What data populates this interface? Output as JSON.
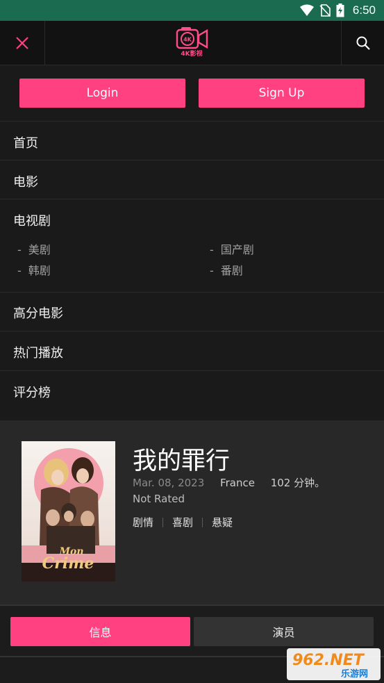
{
  "status_bar": {
    "time": "6:50"
  },
  "header": {
    "logo_text": "4K影视",
    "logo_badge": "4K"
  },
  "auth": {
    "login_label": "Login",
    "signup_label": "Sign Up"
  },
  "menu": {
    "home": "首页",
    "movies": "电影",
    "tv": "电视剧",
    "tv_sub": [
      "美剧",
      "国产剧",
      "韩剧",
      "番剧"
    ],
    "top_rated_movies": "高分电影",
    "hot": "热门播放",
    "ranking": "评分榜"
  },
  "movie": {
    "title": "我的罪行",
    "date": "Mar. 08, 2023",
    "country": "France",
    "runtime": "102 分钟。",
    "rating": "Not Rated",
    "genres": [
      "剧情",
      "喜剧",
      "悬疑"
    ],
    "poster_text": [
      "Mon",
      "Crime"
    ]
  },
  "tabs": {
    "info": "信息",
    "cast": "演员"
  },
  "watermark": {
    "brand": "962.NET",
    "sub": "乐游网"
  },
  "colors": {
    "accent": "#ff4081",
    "status_bar": "#1a6b50",
    "background": "#1a1a1a"
  }
}
